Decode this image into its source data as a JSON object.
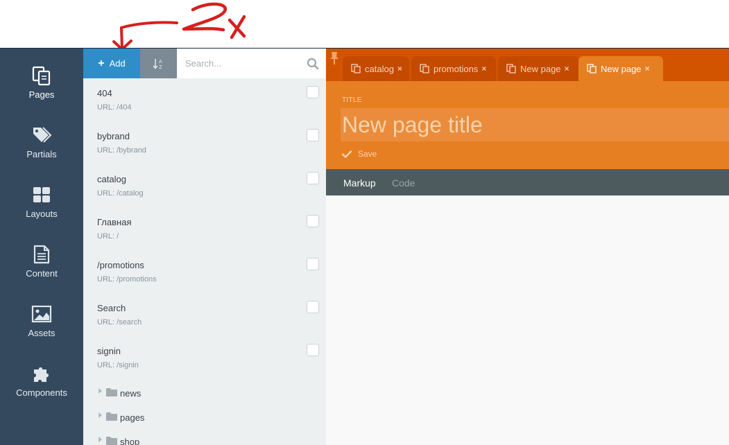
{
  "annotation": {
    "text": "2x",
    "stroke_color": "#d62020"
  },
  "sidebar": {
    "items": [
      {
        "label": "Pages",
        "icon": "pages-icon",
        "active": true
      },
      {
        "label": "Partials",
        "icon": "tags-icon",
        "active": false
      },
      {
        "label": "Layouts",
        "icon": "layouts-icon",
        "active": false
      },
      {
        "label": "Content",
        "icon": "document-icon",
        "active": false
      },
      {
        "label": "Assets",
        "icon": "image-icon",
        "active": false
      },
      {
        "label": "Components",
        "icon": "puzzle-icon",
        "active": false
      }
    ]
  },
  "toolbar": {
    "add_label": "Add",
    "sort_icon": "sort-alpha-icon",
    "search_placeholder": "Search...",
    "search_icon": "search-icon"
  },
  "pages": [
    {
      "name": "404",
      "url": "URL: /404"
    },
    {
      "name": "bybrand",
      "url": "URL: /bybrand"
    },
    {
      "name": "catalog",
      "url": "URL: /catalog"
    },
    {
      "name": "Главная",
      "url": "URL: /"
    },
    {
      "name": "/promotions",
      "url": "URL: /promotions"
    },
    {
      "name": "Search",
      "url": "URL: /search"
    },
    {
      "name": "signin",
      "url": "URL: /signin"
    }
  ],
  "folders": [
    {
      "name": "news"
    },
    {
      "name": "pages"
    },
    {
      "name": "shop"
    }
  ],
  "tabs": [
    {
      "label": "catalog",
      "close": "×",
      "active": false
    },
    {
      "label": "promotions",
      "close": "×",
      "active": false
    },
    {
      "label": "New page",
      "close": "×",
      "active": false
    },
    {
      "label": "New page",
      "close": "×",
      "active": true
    }
  ],
  "editor": {
    "title_label": "TITLE",
    "title_placeholder": "New page title",
    "save_label": "Save",
    "modes": [
      {
        "label": "Markup",
        "active": true
      },
      {
        "label": "Code",
        "active": false
      }
    ]
  },
  "colors": {
    "sidebar_bg": "#34495e",
    "accent_blue": "#2f8ec8",
    "tabbar_bg": "#d35400",
    "editor_orange": "#e67e22",
    "mode_bar": "#4d5b5e"
  }
}
